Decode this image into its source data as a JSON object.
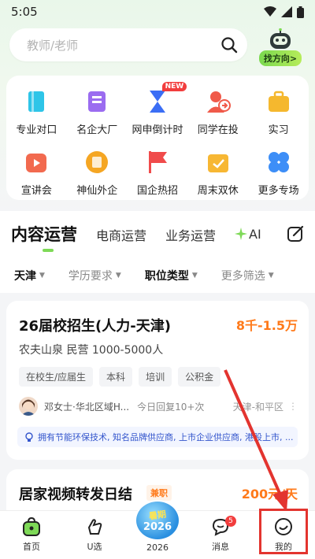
{
  "status": {
    "time": "5:05"
  },
  "search": {
    "placeholder": "教师/老师"
  },
  "direction": {
    "label": "找方向>"
  },
  "quick_links": [
    {
      "label": "专业对口",
      "icon": "book-icon",
      "color": "#2ec5e8"
    },
    {
      "label": "名企大厂",
      "icon": "building-icon",
      "color": "#9b6cf0"
    },
    {
      "label": "网申倒计时",
      "icon": "hourglass-icon",
      "color": "#3b6ef5",
      "badge": "NEW"
    },
    {
      "label": "同学在投",
      "icon": "classmate-icon",
      "color": "#f05a4a"
    },
    {
      "label": "实习",
      "icon": "briefcase-icon",
      "color": "#f5b82e"
    },
    {
      "label": "宣讲会",
      "icon": "video-icon",
      "color": "#f26a4f"
    },
    {
      "label": "神仙外企",
      "icon": "coin-icon",
      "color": "#f5a623"
    },
    {
      "label": "国企热招",
      "icon": "flag-icon",
      "color": "#f04b4b"
    },
    {
      "label": "周末双休",
      "icon": "calendar-icon",
      "color": "#f7b733"
    },
    {
      "label": "更多专场",
      "icon": "clover-icon",
      "color": "#3d8ef7"
    }
  ],
  "tabs": {
    "active": "内容运营",
    "t2": "电商运营",
    "t3": "业务运营",
    "t4": "AI"
  },
  "filters": {
    "city": "天津",
    "edu": "学历要求",
    "type": "职位类型",
    "more": "更多筛选"
  },
  "job1": {
    "title": "26届校招生(人力-天津)",
    "salary": "8千-1.5万",
    "company": "农夫山泉  民营  1000-5000人",
    "tags": [
      "在校生/应届生",
      "本科",
      "培训",
      "公积金"
    ],
    "recruiter": "邓女士·华北区域H...",
    "reply": "今日回复10+次",
    "location": "天津-和平区",
    "benefit": "拥有节能环保技术, 知名品牌供应商, 上市企业供应商, 港股上市, ..."
  },
  "job2": {
    "title": "居家视频转发日结",
    "badge": "兼职",
    "salary": "200元/天"
  },
  "nav": {
    "home": "首页",
    "u": "U选",
    "summer_top": "暑期",
    "summer_num": "2026",
    "y2026": "2026",
    "msg": "消息",
    "msg_badge": "5",
    "mine": "我的"
  }
}
